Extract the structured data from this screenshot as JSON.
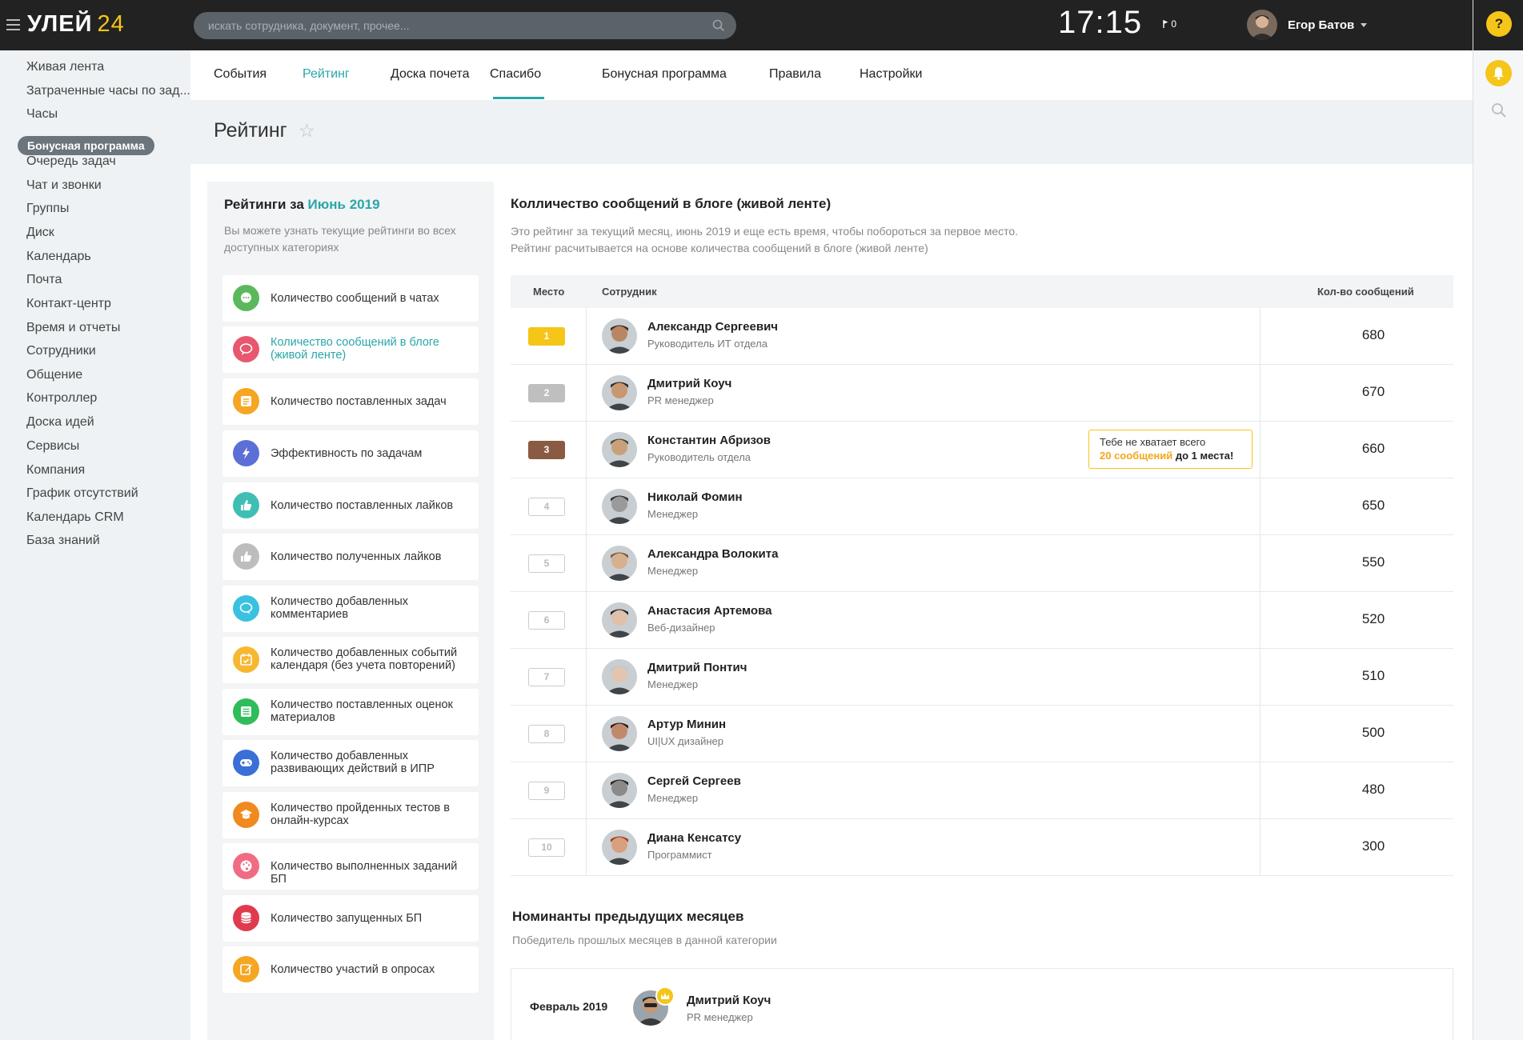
{
  "topbar": {
    "logo_text": "УЛЕЙ",
    "logo_num": "24",
    "search_placeholder": "искать сотрудника, документ, прочее...",
    "clock": "17:15",
    "flag_count": "0",
    "user_name": "Егор Батов"
  },
  "rail": {
    "help": "?"
  },
  "sidebar": {
    "items": [
      "Живая лента",
      "Затраченные часы по зад...",
      "Часы",
      "Бонусная программа",
      "Очередь задач",
      "Чат и звонки",
      "Группы",
      "Диск",
      "Календарь",
      "Почта",
      "Контакт-центр",
      "Время и отчеты",
      "Сотрудники",
      "Общение",
      "Контроллер",
      "Доска идей",
      "Сервисы",
      "Компания",
      "График отсутствий",
      "Календарь CRM",
      "База знаний"
    ],
    "active_index": 3
  },
  "tabs": [
    "События",
    "Рейтинг",
    "Доска почета",
    "Спасибо",
    "Бонусная программа",
    "Правила",
    "Настройки"
  ],
  "page": {
    "title": "Рейтинг",
    "star": "☆"
  },
  "categories_panel": {
    "head_prefix": "Рейтинги за ",
    "head_month": "Июнь 2019",
    "desc": "Вы можете узнать текущие рейтинги во всех доступных категориях",
    "items": [
      {
        "label": "Количество сообщений в чатах",
        "color": "#5cb85c",
        "icon": "chat-icon"
      },
      {
        "label": "Количество сообщений в блоге (живой ленте)",
        "color": "#e8566f",
        "icon": "blog-icon"
      },
      {
        "label": "Количество поставленных задач",
        "color": "#f5a623",
        "icon": "tasks-icon"
      },
      {
        "label": "Эффективность по задачам",
        "color": "#5b6fd6",
        "icon": "lightning-icon"
      },
      {
        "label": "Количество поставленных лайков",
        "color": "#3fbfb4",
        "icon": "thumbs-up-icon"
      },
      {
        "label": "Количество полученных лайков",
        "color": "#bdbdbd",
        "icon": "thumbs-up-icon"
      },
      {
        "label": "Количество добавленных комментариев",
        "color": "#3bc1e0",
        "icon": "comment-icon"
      },
      {
        "label": "Количество добавленных событий календаря (без учета повторений)",
        "color": "#f7b731",
        "icon": "calendar-icon"
      },
      {
        "label": "Количество поставленных оценок материалов",
        "color": "#2ebd59",
        "icon": "list-icon"
      },
      {
        "label": "Количество добавленных развивающих действий в ИПР",
        "color": "#3a6fd8",
        "icon": "gamepad-icon"
      },
      {
        "label": "Количество пройденных тестов в онлайн-курсах",
        "color": "#f08a1e",
        "icon": "graduation-cap-icon"
      },
      {
        "label": "Количество выполненных заданий БП",
        "color": "#f06b83",
        "icon": "palette-icon"
      },
      {
        "label": "Количество запущенных БП",
        "color": "#e03a4e",
        "icon": "database-icon"
      },
      {
        "label": "Количество участий в опросах",
        "color": "#f5a623",
        "icon": "edit-icon"
      }
    ],
    "active_index": 1
  },
  "rating": {
    "title": "Колличество сообщений в блоге (живой ленте)",
    "desc_line1": "Это рейтинг за текущий месяц, июнь 2019 и еще есть время, чтобы побороться за первое место.",
    "desc_line2": "Рейтинг расчитывается на основе количества сообщений в блоге (живой ленте)",
    "col_place": "Место",
    "col_employee": "Сотрудник",
    "col_count": "Кол-во сообщений",
    "rows": [
      {
        "place": "1",
        "name": "Александр Сергеевич",
        "role": "Руководитель ИТ отдела",
        "count": "680",
        "skin": "#b98563",
        "hair": "#3a2a20"
      },
      {
        "place": "2",
        "name": "Дмитрий Коуч",
        "role": "PR менеджер",
        "count": "670",
        "skin": "#c89870",
        "hair": "#2a2a2a"
      },
      {
        "place": "3",
        "name": "Константин Абризов",
        "role": "Руководитель отдела",
        "count": "660",
        "skin": "#c9a07a",
        "hair": "#4a4a3a"
      },
      {
        "place": "4",
        "name": "Николай Фомин",
        "role": "Менеджер",
        "count": "650",
        "skin": "#9a9a9a",
        "hair": "#333"
      },
      {
        "place": "5",
        "name": "Александра Волокита",
        "role": "Менеджер",
        "count": "550",
        "skin": "#d7b090",
        "hair": "#7a5a3a"
      },
      {
        "place": "6",
        "name": "Анастасия Артемова",
        "role": "Веб-дизайнер",
        "count": "520",
        "skin": "#e0c0a8",
        "hair": "#222"
      },
      {
        "place": "7",
        "name": "Дмитрий Понтич",
        "role": "Менеджер",
        "count": "510",
        "skin": "#e2c4b0",
        "hair": "#bcc8d4"
      },
      {
        "place": "8",
        "name": "Артур Минин",
        "role": "UI|UX дизайнер",
        "count": "500",
        "skin": "#c08a6a",
        "hair": "#2a1a10"
      },
      {
        "place": "9",
        "name": "Сергей Сергеев",
        "role": "Менеджер",
        "count": "480",
        "skin": "#8a8a8a",
        "hair": "#222"
      },
      {
        "place": "10",
        "name": "Диана Кенсатсу",
        "role": "Программист",
        "count": "300",
        "skin": "#d8a080",
        "hair": "#a0401a"
      }
    ],
    "tooltip": {
      "line1": "Тебе не хватает всего",
      "highlight": "20 сообщений",
      "rest": " до 1 места!"
    }
  },
  "nominees": {
    "title": "Номинанты предыдущих месяцев",
    "desc": "Победитель прошлых месяцев в данной категории",
    "items": [
      {
        "month": "Февраль 2019",
        "name": "Дмитрий Коуч",
        "role": "PR менеджер"
      }
    ]
  }
}
